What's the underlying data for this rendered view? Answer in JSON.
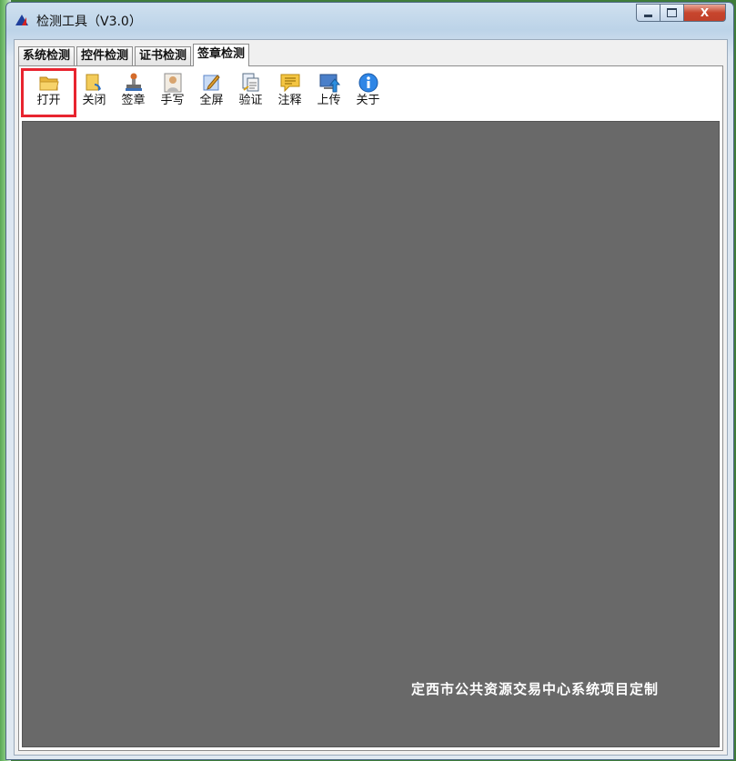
{
  "window": {
    "title": "检测工具（V3.0）",
    "controls": {
      "minimize": "",
      "maximize": "",
      "close": "X"
    }
  },
  "tabs": [
    {
      "label": "系统检测"
    },
    {
      "label": "控件检测"
    },
    {
      "label": "证书检测"
    },
    {
      "label": "签章检测",
      "active": true
    }
  ],
  "toolbar": [
    {
      "label": "打开",
      "icon": "folder-open-icon",
      "highlighted": true
    },
    {
      "label": "关闭",
      "icon": "document-close-icon"
    },
    {
      "label": "签章",
      "icon": "stamp-icon"
    },
    {
      "label": "手写",
      "icon": "handwrite-icon"
    },
    {
      "label": "全屏",
      "icon": "fullscreen-icon"
    },
    {
      "label": "验证",
      "icon": "verify-icon"
    },
    {
      "label": "注释",
      "icon": "comment-icon"
    },
    {
      "label": "上传",
      "icon": "upload-icon"
    },
    {
      "label": "关于",
      "icon": "info-icon"
    }
  ],
  "viewer": {
    "footer_note": "定西市公共资源交易中心系统项目定制"
  },
  "colors": {
    "highlight": "#e8242f",
    "viewer_bg": "#696969"
  }
}
